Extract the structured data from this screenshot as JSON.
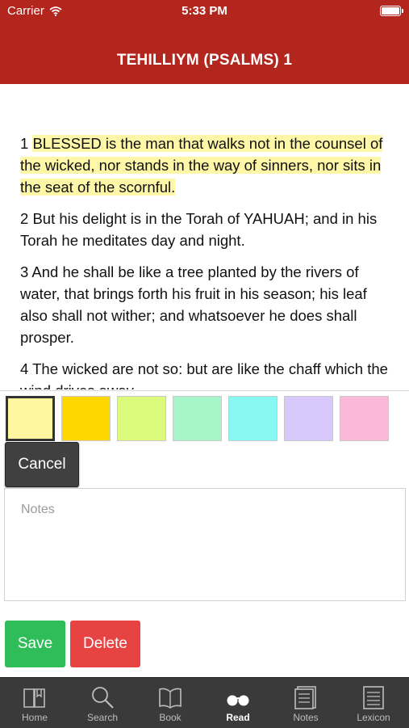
{
  "status_bar": {
    "carrier": "Carrier",
    "time": "5:33 PM"
  },
  "header": {
    "title": "TEHILLIYM (PSALMS) 1"
  },
  "verses": [
    {
      "num": "1",
      "text": "BLESSED is the man that walks not in the counsel of the wicked, nor stands in the way of sinners, nor sits in the seat of the scornful.",
      "highlight": "#fff7a8"
    },
    {
      "num": "2",
      "text": "But his delight is in the Torah of YAHUAH; and in his Torah he meditates day and night."
    },
    {
      "num": "3",
      "text": "And he shall be like a tree planted by the rivers of water, that brings forth his fruit in his season; his leaf also shall not wither; and whatsoever he does shall prosper."
    },
    {
      "num": "4",
      "text": "The wicked are not so: but are like the chaff which the wind drives away."
    }
  ],
  "highlight_colors": [
    "#fff6a0",
    "#ffd700",
    "#dcfb7d",
    "#a6f6c9",
    "#88f8f2",
    "#d8c8fb",
    "#fcb8d8"
  ],
  "selected_color_index": 0,
  "actions": {
    "cancel_label": "Cancel",
    "save_label": "Save",
    "delete_label": "Delete"
  },
  "notes": {
    "placeholder": "Notes",
    "value": ""
  },
  "tabbar": {
    "items": [
      {
        "label": "Home",
        "icon": "book-open-icon"
      },
      {
        "label": "Search",
        "icon": "search-icon"
      },
      {
        "label": "Book",
        "icon": "book-icon"
      },
      {
        "label": "Read",
        "icon": "glasses-icon",
        "active": true
      },
      {
        "label": "Notes",
        "icon": "notes-icon"
      },
      {
        "label": "Lexicon",
        "icon": "lexicon-icon"
      }
    ]
  },
  "colors": {
    "header_bg": "#b3261e",
    "save_bg": "#2ebd59",
    "delete_bg": "#e74343",
    "tabbar_bg": "#3a3a3a"
  }
}
